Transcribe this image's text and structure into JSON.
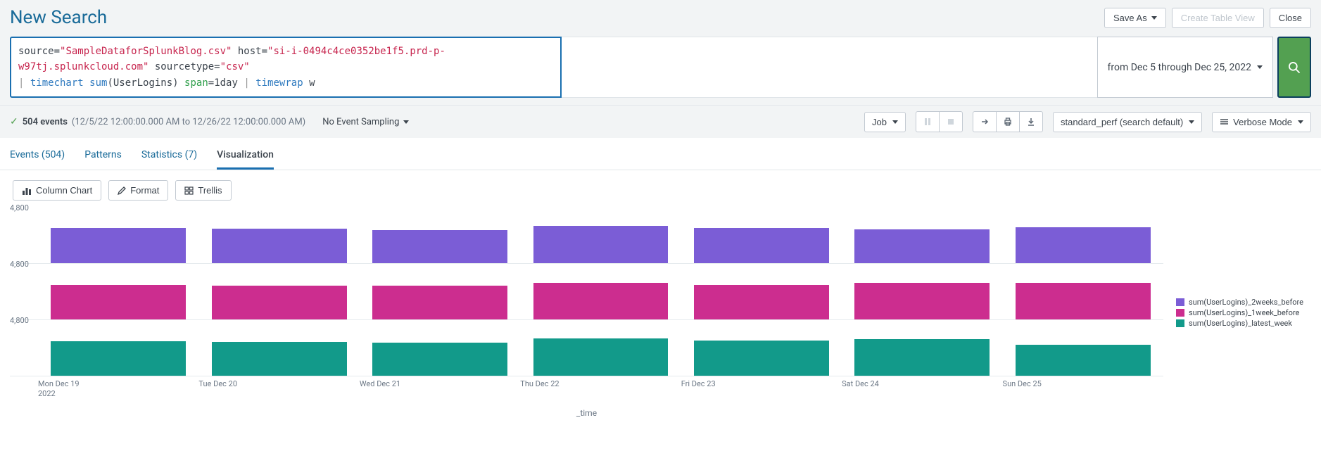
{
  "header": {
    "title": "New Search",
    "save_as": "Save As",
    "create_table_view": "Create Table View",
    "close": "Close"
  },
  "search": {
    "time_range": "from Dec 5 through Dec 25, 2022",
    "query_tokens": [
      {
        "t": "plain",
        "v": "source="
      },
      {
        "t": "str",
        "v": "\"SampleDataforSplunkBlog.csv\""
      },
      {
        "t": "plain",
        "v": " host="
      },
      {
        "t": "str",
        "v": "\"si-i-0494c4ce0352be1f5.prd-p-w97tj.splunkcloud.com\""
      },
      {
        "t": "plain",
        "v": " sourcetype="
      },
      {
        "t": "str",
        "v": "\"csv\""
      },
      {
        "t": "br"
      },
      {
        "t": "pipe",
        "v": "| "
      },
      {
        "t": "kw",
        "v": "timechart"
      },
      {
        "t": "plain",
        "v": " "
      },
      {
        "t": "kw",
        "v": "sum"
      },
      {
        "t": "plain",
        "v": "(UserLogins) "
      },
      {
        "t": "num",
        "v": "span"
      },
      {
        "t": "plain",
        "v": "="
      },
      {
        "t": "plain",
        "v": "1day"
      },
      {
        "t": "plain",
        "v": " "
      },
      {
        "t": "pipe",
        "v": "| "
      },
      {
        "t": "kw",
        "v": "timewrap"
      },
      {
        "t": "plain",
        "v": "  w"
      }
    ]
  },
  "meta": {
    "event_count": "504 events",
    "range": "(12/5/22 12:00:00.000 AM to 12/26/22 12:00:00.000 AM)",
    "sampling": "No Event Sampling",
    "job_label": "Job",
    "mode_label": "standard_perf (search default)",
    "verbose_label": "Verbose Mode"
  },
  "tabs": {
    "events": "Events (504)",
    "patterns": "Patterns",
    "statistics": "Statistics (7)",
    "visualization": "Visualization"
  },
  "viz_toolbar": {
    "chart_type": "Column Chart",
    "format": "Format",
    "trellis": "Trellis"
  },
  "chart_data": {
    "type": "bar",
    "trellis_rows": 3,
    "categories": [
      "Mon Dec 19",
      "Tue Dec 20",
      "Wed Dec 21",
      "Thu Dec 22",
      "Fri Dec 23",
      "Sat Dec 24",
      "Sun Dec 25"
    ],
    "category_year": "2022",
    "ylabel_tick": "4,800",
    "ylim": [
      0,
      6000
    ],
    "xlabel": "_time",
    "series": [
      {
        "name": "sum(UserLogins)_2weeks_before",
        "color": "#7b5dd6",
        "values": [
          5200,
          5100,
          4900,
          5500,
          5200,
          5000,
          5300
        ]
      },
      {
        "name": "sum(UserLogins)_1week_before",
        "color": "#cc2d8f",
        "values": [
          5100,
          5000,
          4950,
          5400,
          5100,
          5350,
          5400
        ]
      },
      {
        "name": "sum(UserLogins)_latest_week",
        "color": "#129a8a",
        "values": [
          5100,
          5000,
          4900,
          5500,
          5200,
          5400,
          4600
        ]
      }
    ]
  }
}
